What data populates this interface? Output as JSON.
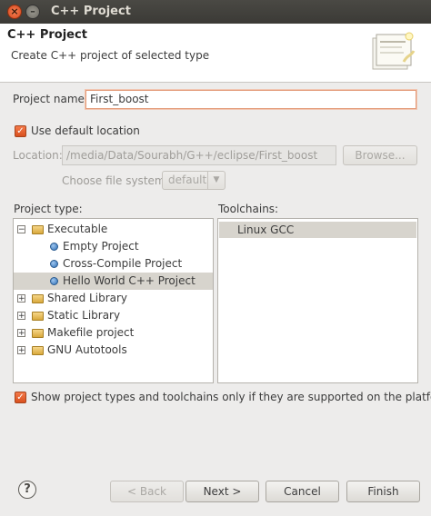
{
  "window": {
    "title": "C++ Project",
    "close_glyph": "×",
    "minimize_glyph": "–"
  },
  "header": {
    "title": "C++ Project",
    "subtitle": "Create C++ project of selected type",
    "icon": "wizard-banner-icon"
  },
  "form": {
    "project_name_label": "Project name:",
    "project_name_value": "First_boost",
    "use_default_location_label": "Use default location",
    "use_default_location_checked": true,
    "location_label": "Location:",
    "location_value": "/media/Data/Sourabh/G++/eclipse/First_boost",
    "browse_label": "Browse...",
    "file_system_label": "Choose file system:",
    "file_system_value": "default"
  },
  "project_type": {
    "label": "Project type:",
    "items": [
      {
        "label": "Executable",
        "expander": "−",
        "icon": "folder-icon"
      },
      {
        "label": "Empty Project",
        "icon": "project-bullet-icon"
      },
      {
        "label": "Cross-Compile Project",
        "icon": "project-bullet-icon"
      },
      {
        "label": "Hello World C++ Project",
        "icon": "project-bullet-icon",
        "selected": true
      },
      {
        "label": "Shared Library",
        "expander": "+",
        "icon": "folder-icon"
      },
      {
        "label": "Static Library",
        "expander": "+",
        "icon": "folder-icon"
      },
      {
        "label": "Makefile project",
        "expander": "+",
        "icon": "folder-icon"
      },
      {
        "label": "GNU Autotools",
        "expander": "+",
        "icon": "folder-icon"
      }
    ]
  },
  "toolchains": {
    "label": "Toolchains:",
    "items": [
      {
        "label": "Linux GCC",
        "selected": true
      }
    ]
  },
  "filter": {
    "label": "Show project types and toolchains only if they are supported on the platform",
    "checked": true
  },
  "buttons": {
    "help": "?",
    "back": "< Back",
    "next": "Next >",
    "cancel": "Cancel",
    "finish": "Finish"
  },
  "colors": {
    "accent": "#e0582a",
    "selection": "#d7d4cd",
    "titlebar": "#3c3b37"
  }
}
